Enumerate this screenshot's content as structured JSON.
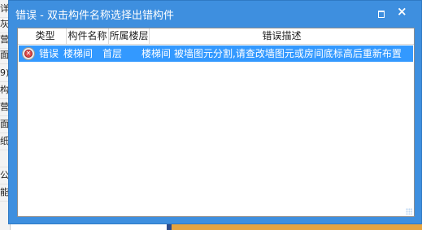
{
  "background": {
    "left_rows": [
      "详",
      "灰",
      "营",
      "面",
      "9)",
      "构",
      "营",
      "面",
      "纸",
      "",
      "公",
      "能"
    ]
  },
  "dialog": {
    "title": "错误 - 双击构件名称选择出错构件",
    "maximize_glyph": "□",
    "close_glyph": "×",
    "colors": {
      "title_bar": "#3e8fdf",
      "selection": "#3399ff",
      "error_icon": "#d94848"
    }
  },
  "table": {
    "columns": [
      "类型",
      "构件名称",
      "所属楼层",
      "错误描述"
    ],
    "rows": [
      {
        "icon": "error-circle-icon",
        "type": "错误",
        "component": "楼梯间",
        "floor": "首层",
        "component_name": "楼梯间",
        "description": "被墙图元分割,请查改墙图元或房间底标高后重新布置",
        "selected": true
      }
    ]
  }
}
